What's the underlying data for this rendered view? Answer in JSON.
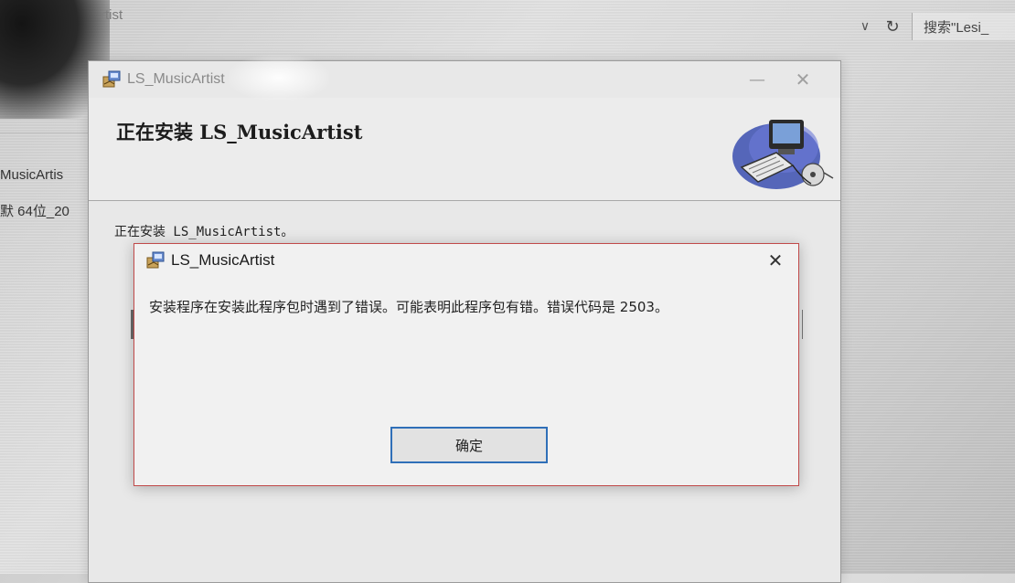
{
  "explorer": {
    "title_fragment": "rtist",
    "search_text": "搜索\"Lesi_",
    "file_name": "MusicArtis",
    "file_desc": "默 64位_20"
  },
  "installer": {
    "title": "LS_MusicArtist",
    "header_title": "正在安装 LS_MusicArtist",
    "status": "正在安装 LS_MusicArtist。",
    "minimize_symbol": "—",
    "close_symbol": "✕"
  },
  "error_dialog": {
    "title": "LS_MusicArtist",
    "message": "安装程序在安装此程序包时遇到了错误。可能表明此程序包有错。错误代码是 2503。",
    "ok_label": "确定",
    "close_symbol": "✕"
  },
  "icons": {
    "app": "installer-package-icon",
    "header": "computer-setup-icon",
    "refresh": "refresh-icon",
    "chevron": "chevron-down-icon"
  }
}
